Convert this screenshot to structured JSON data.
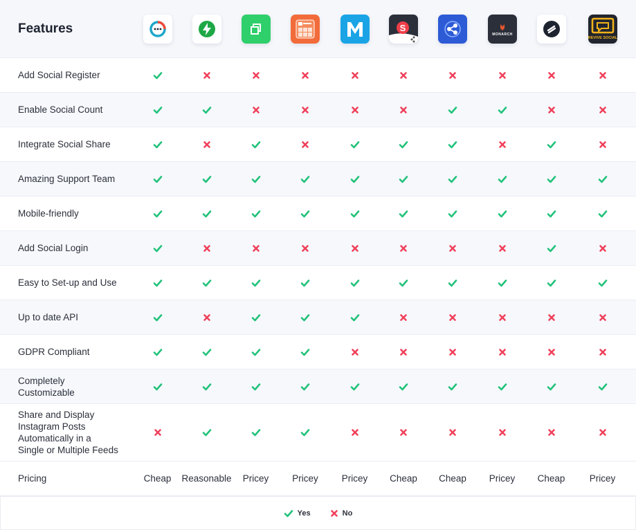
{
  "header": {
    "title": "Features"
  },
  "plugins": [
    {
      "icon": "chat-bubble-logo-icon",
      "bg": "#ffffff",
      "fg": "#1ea7c9"
    },
    {
      "icon": "jetpack-bolt-logo-icon",
      "bg": "#ffffff",
      "fg": "#1fa846"
    },
    {
      "icon": "copy-squares-logo-icon",
      "bg": "#2fcf6b",
      "fg": "#ffffff"
    },
    {
      "icon": "grid-card-logo-icon",
      "bg": "#f26b3a",
      "fg": "#ffffff"
    },
    {
      "icon": "m-letter-logo-icon",
      "bg": "#1aa4e6",
      "fg": "#ffffff"
    },
    {
      "icon": "s-share-logo-icon",
      "bg": "#2b2f3a",
      "fg": "#ffffff"
    },
    {
      "icon": "share-network-logo-icon",
      "bg": "#2d5bd6",
      "fg": "#ffffff"
    },
    {
      "icon": "monarch-logo-icon",
      "bg": "#2b2f3a",
      "fg": "#ffffff"
    },
    {
      "icon": "slash-circle-logo-icon",
      "bg": "#ffffff",
      "fg": "#1e2330"
    },
    {
      "icon": "revive-social-logo-icon",
      "bg": "#20242e",
      "fg": "#f2b21a"
    }
  ],
  "features": [
    {
      "label": "Add Social Register",
      "values": [
        1,
        0,
        0,
        0,
        0,
        0,
        0,
        0,
        0,
        0
      ]
    },
    {
      "label": "Enable Social Count",
      "values": [
        1,
        1,
        0,
        0,
        0,
        0,
        1,
        1,
        0,
        0
      ]
    },
    {
      "label": "Integrate Social Share",
      "values": [
        1,
        0,
        1,
        0,
        1,
        1,
        1,
        0,
        1,
        0
      ]
    },
    {
      "label": "Amazing Support Team",
      "values": [
        1,
        1,
        1,
        1,
        1,
        1,
        1,
        1,
        1,
        1
      ]
    },
    {
      "label": "Mobile-friendly",
      "values": [
        1,
        1,
        1,
        1,
        1,
        1,
        1,
        1,
        1,
        1
      ]
    },
    {
      "label": "Add Social Login",
      "values": [
        1,
        0,
        0,
        0,
        0,
        0,
        0,
        0,
        1,
        0
      ]
    },
    {
      "label": "Easy to Set-up and Use",
      "values": [
        1,
        1,
        1,
        1,
        1,
        1,
        1,
        1,
        1,
        1
      ]
    },
    {
      "label": "Up to date API",
      "values": [
        1,
        0,
        1,
        1,
        1,
        0,
        0,
        0,
        0,
        0
      ]
    },
    {
      "label": "GDPR Compliant",
      "values": [
        1,
        1,
        1,
        1,
        0,
        0,
        0,
        0,
        0,
        0
      ]
    },
    {
      "label": "Completely Customizable",
      "values": [
        1,
        1,
        1,
        1,
        1,
        1,
        1,
        1,
        1,
        1
      ]
    },
    {
      "label": "Share and Display Instagram Posts Automatically in a Single or Multiple Feeds",
      "values": [
        0,
        1,
        1,
        1,
        0,
        0,
        0,
        0,
        0,
        0
      ]
    }
  ],
  "pricing": {
    "label": "Pricing",
    "values": [
      "Cheap",
      "Reasonable",
      "Pricey",
      "Pricey",
      "Pricey",
      "Cheap",
      "Cheap",
      "Pricey",
      "Cheap",
      "Pricey"
    ]
  },
  "legend": {
    "yes": "Yes",
    "no": "No"
  },
  "colors": {
    "yes": "#22c27a",
    "no": "#f0405a"
  }
}
